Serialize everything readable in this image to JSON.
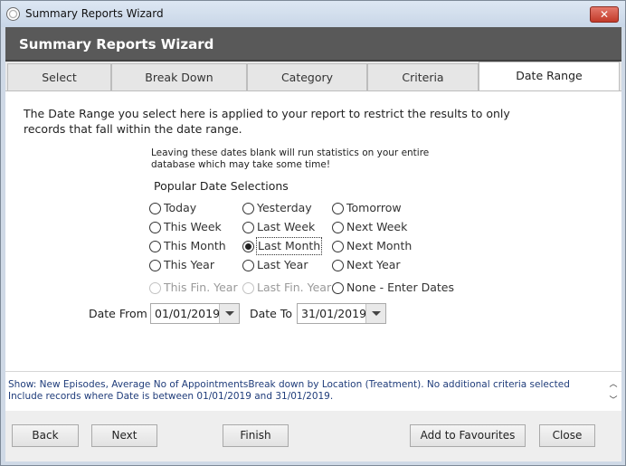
{
  "window": {
    "title": "Summary Reports Wizard",
    "close_glyph": "✕"
  },
  "header": {
    "title": "Summary Reports Wizard"
  },
  "tabs": [
    {
      "label": "Select"
    },
    {
      "label": "Break Down"
    },
    {
      "label": "Category"
    },
    {
      "label": "Criteria"
    },
    {
      "label": "Date Range",
      "active": true
    }
  ],
  "date_range": {
    "intro": "The Date Range you select here is applied to your report to restrict the results to only records that fall within the date range.",
    "note": "Leaving these dates blank will run statistics on your entire database which may take some time!",
    "popular_label": "Popular Date Selections",
    "options": {
      "today": "Today",
      "yesterday": "Yesterday",
      "tomorrow": "Tomorrow",
      "this_week": "This Week",
      "last_week": "Last Week",
      "next_week": "Next Week",
      "this_month": "This Month",
      "last_month": "Last Month",
      "next_month": "Next Month",
      "this_year": "This Year",
      "last_year": "Last Year",
      "next_year": "Next Year",
      "this_fin_year": "This Fin. Year",
      "last_fin_year": "Last Fin. Year",
      "none_enter_dates": "None - Enter Dates"
    },
    "selected_option": "Last Month",
    "date_from_label": "Date From",
    "date_from_value": "01/01/2019",
    "date_to_label": "Date To",
    "date_to_value": "31/01/2019"
  },
  "summary": {
    "text": "Show: New Episodes, Average No of AppointmentsBreak down by Location (Treatment). No additional criteria selected Include records where Date is between 01/01/2019 and 31/01/2019."
  },
  "footer": {
    "back": "Back",
    "next": "Next",
    "finish": "Finish",
    "add_to_favourites": "Add to Favourites",
    "close": "Close"
  },
  "colors": {
    "header_bg": "#595959",
    "summary_text": "#1f3c7a",
    "close_button": "#c23a2a"
  }
}
